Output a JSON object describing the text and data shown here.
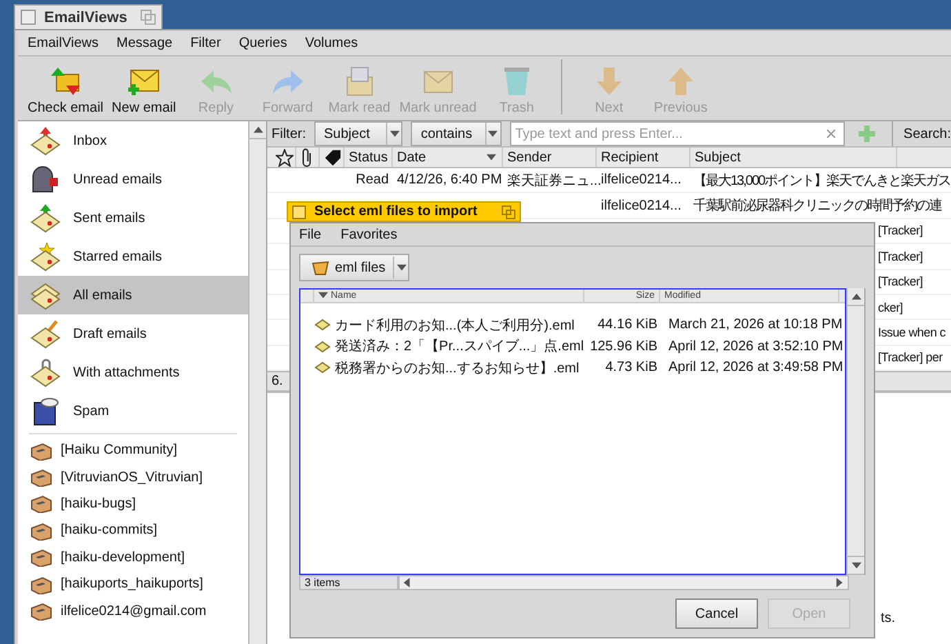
{
  "window": {
    "title": "EmailViews"
  },
  "menu": [
    "EmailViews",
    "Message",
    "Filter",
    "Queries",
    "Volumes"
  ],
  "toolbar": [
    {
      "kind": "check",
      "label": "Check email",
      "disabled": false
    },
    {
      "kind": "new",
      "label": "New email",
      "disabled": false
    },
    {
      "kind": "reply",
      "label": "Reply",
      "disabled": true
    },
    {
      "kind": "forward",
      "label": "Forward",
      "disabled": true
    },
    {
      "kind": "read",
      "label": "Mark read",
      "disabled": true
    },
    {
      "kind": "unread",
      "label": "Mark unread",
      "disabled": true
    },
    {
      "kind": "trash",
      "label": "Trash",
      "disabled": true
    },
    {
      "kind": "separator"
    },
    {
      "kind": "next",
      "label": "Next",
      "disabled": true
    },
    {
      "kind": "previous",
      "label": "Previous",
      "disabled": true
    }
  ],
  "sidebar": {
    "mailboxes": [
      {
        "kind": "inbox",
        "label": "Inbox",
        "selected": false
      },
      {
        "kind": "unread",
        "label": "Unread emails",
        "selected": false
      },
      {
        "kind": "sent",
        "label": "Sent emails",
        "selected": false
      },
      {
        "kind": "starred",
        "label": "Starred emails",
        "selected": false
      },
      {
        "kind": "all",
        "label": "All emails",
        "selected": true
      },
      {
        "kind": "draft",
        "label": "Draft emails",
        "selected": false
      },
      {
        "kind": "attachments",
        "label": "With attachments",
        "selected": false
      },
      {
        "kind": "spam",
        "label": "Spam",
        "selected": false
      }
    ],
    "folders": [
      {
        "label": "[Haiku Community]"
      },
      {
        "label": "[VitruvianOS_Vitruvian]"
      },
      {
        "label": "[haiku-bugs]"
      },
      {
        "label": "[haiku-commits]"
      },
      {
        "label": "[haiku-development]"
      },
      {
        "label": "[haikuports_haikuports]"
      },
      {
        "label": "ilfelice0214@gmail.com"
      }
    ]
  },
  "filter": {
    "label": "Filter:",
    "field": "Subject",
    "operator": "contains",
    "placeholder": "Type text and press Enter...",
    "search_label": "Search:"
  },
  "table": {
    "columns": [
      "Status",
      "Date",
      "Sender",
      "Recipient",
      "Subject"
    ],
    "rows": [
      {
        "kind": "full",
        "status": "Read",
        "date": "4/12/26, 6:40 PM",
        "sender": "楽天証券ニュ...",
        "recipient": "ilfelice0214...",
        "subject": "【最大13,000ポイント】楽天でんきと楽天ガス"
      },
      {
        "kind": "partial",
        "recipient": "ilfelice0214...",
        "subject": "千葉駅前泌尿器科クリニックの時間予約の連"
      },
      {
        "kind": "covered",
        "subject": "[Tracker]"
      },
      {
        "kind": "covered",
        "subject": "[Tracker]"
      },
      {
        "kind": "covered",
        "subject": "[Tracker]"
      },
      {
        "kind": "covered",
        "subject": "cker]"
      },
      {
        "kind": "covered",
        "subject": "Issue when c"
      },
      {
        "kind": "covered",
        "subject": "[Tracker] per"
      }
    ]
  },
  "status_bar": {
    "text": "6."
  },
  "preview": {
    "text": "ts."
  },
  "dialog": {
    "title": "Select eml files to import",
    "menu": [
      "File",
      "Favorites"
    ],
    "location": "eml files",
    "columns": [
      "Name",
      "Size",
      "Modified"
    ],
    "files": [
      {
        "name": "カード利用のお知...(本人ご利用分).eml",
        "size": "44.16 KiB",
        "modified": "March 21, 2026 at 10:18 PM"
      },
      {
        "name": "発送済み：2「【Pr...スパイブ...」点.eml",
        "size": "125.96 KiB",
        "modified": "April 12, 2026 at 3:52:10 PM"
      },
      {
        "name": "税務署からのお知...するお知らせ】.eml",
        "size": "4.73 KiB",
        "modified": "April 12, 2026 at 3:49:58 PM"
      }
    ],
    "count": "3 items",
    "buttons": [
      {
        "label": "Cancel",
        "disabled": false
      },
      {
        "label": "Open",
        "disabled": true
      }
    ]
  }
}
